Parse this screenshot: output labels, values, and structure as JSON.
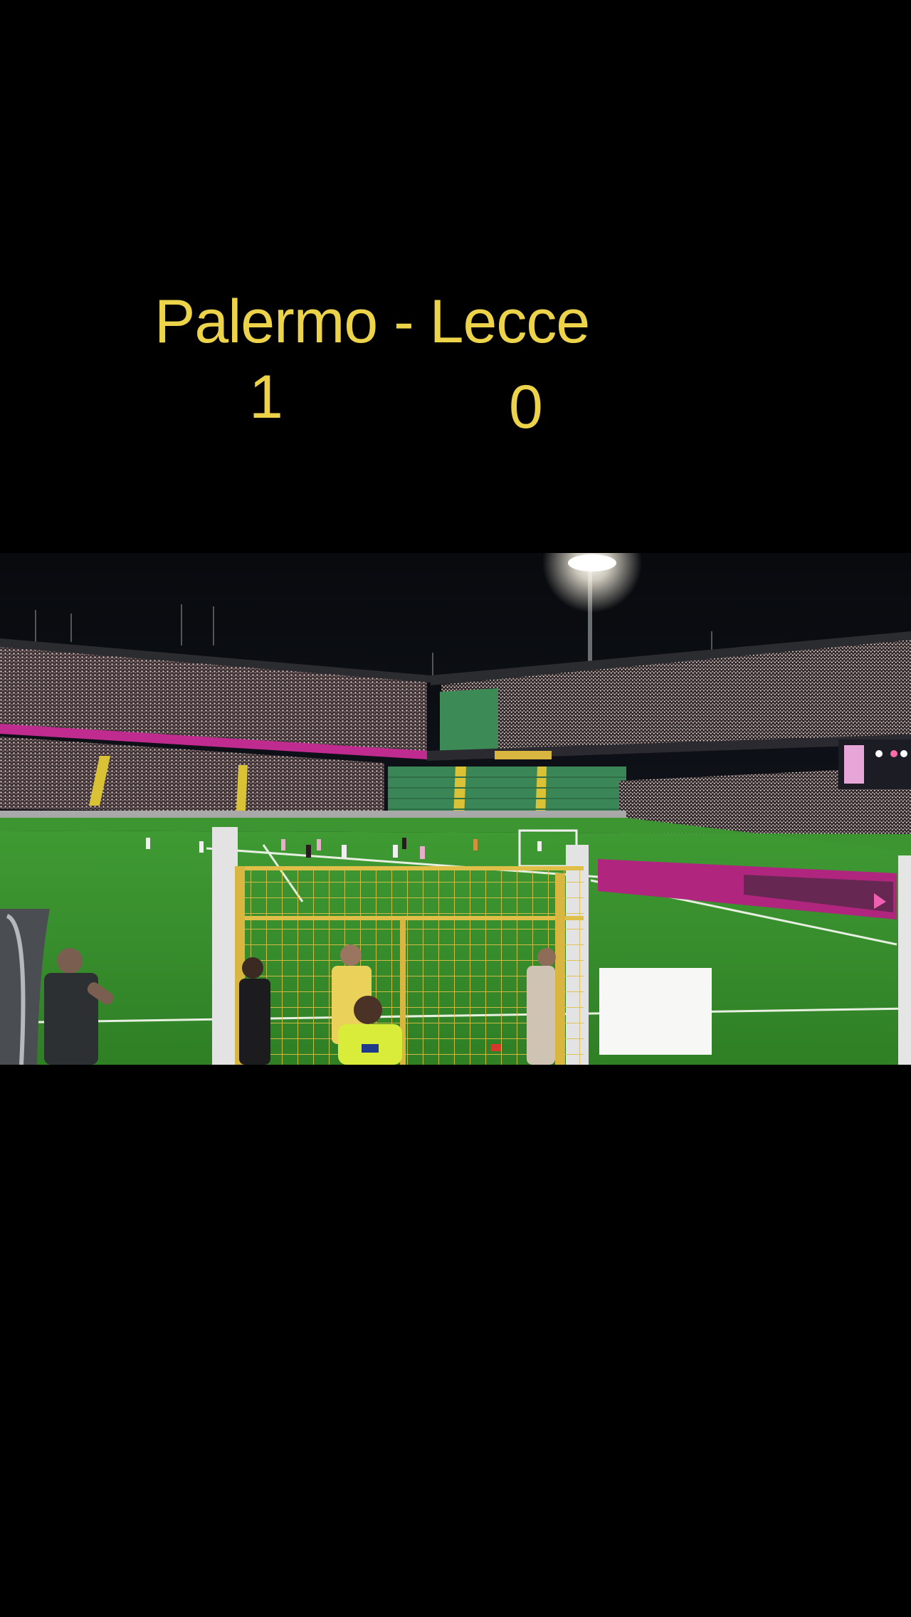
{
  "caption": {
    "match_title": "Palermo - Lecce",
    "home_score": "1",
    "away_score": "0",
    "text_color": "#ecd349"
  },
  "photo": {
    "subject": "stadium-at-night",
    "pitch_color": "#3f9a33",
    "sky_color": "#0b0e12",
    "fence_color": "#d9b640",
    "ad_board_color": "#c02b8f"
  }
}
